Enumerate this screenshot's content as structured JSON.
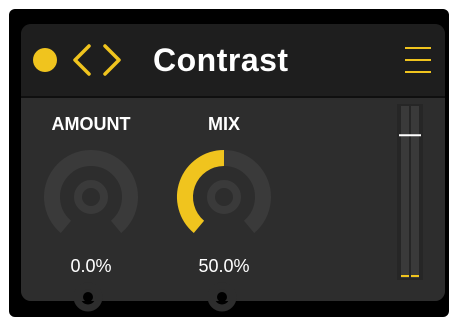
{
  "device": {
    "title": "Contrast",
    "enabled": true,
    "accent_color": "#f0c41e"
  },
  "header": {
    "power_icon": "power-dot-icon",
    "prev_icon": "chevron-left-icon",
    "next_icon": "chevron-right-icon",
    "menu_icon": "hamburger-menu-icon"
  },
  "knobs": [
    {
      "label": "AMOUNT",
      "value_text": "0.0%",
      "value": 0.0
    },
    {
      "label": "MIX",
      "value_text": "50.0%",
      "value": 0.5
    }
  ],
  "meter": {
    "level_marker": 0.83
  },
  "colors": {
    "header_bg": "#1e1e1e",
    "body_bg": "#2d2d2d",
    "knob_track": "#3a3a3a",
    "knob_fill": "#f0c41e",
    "text": "#ffffff"
  }
}
